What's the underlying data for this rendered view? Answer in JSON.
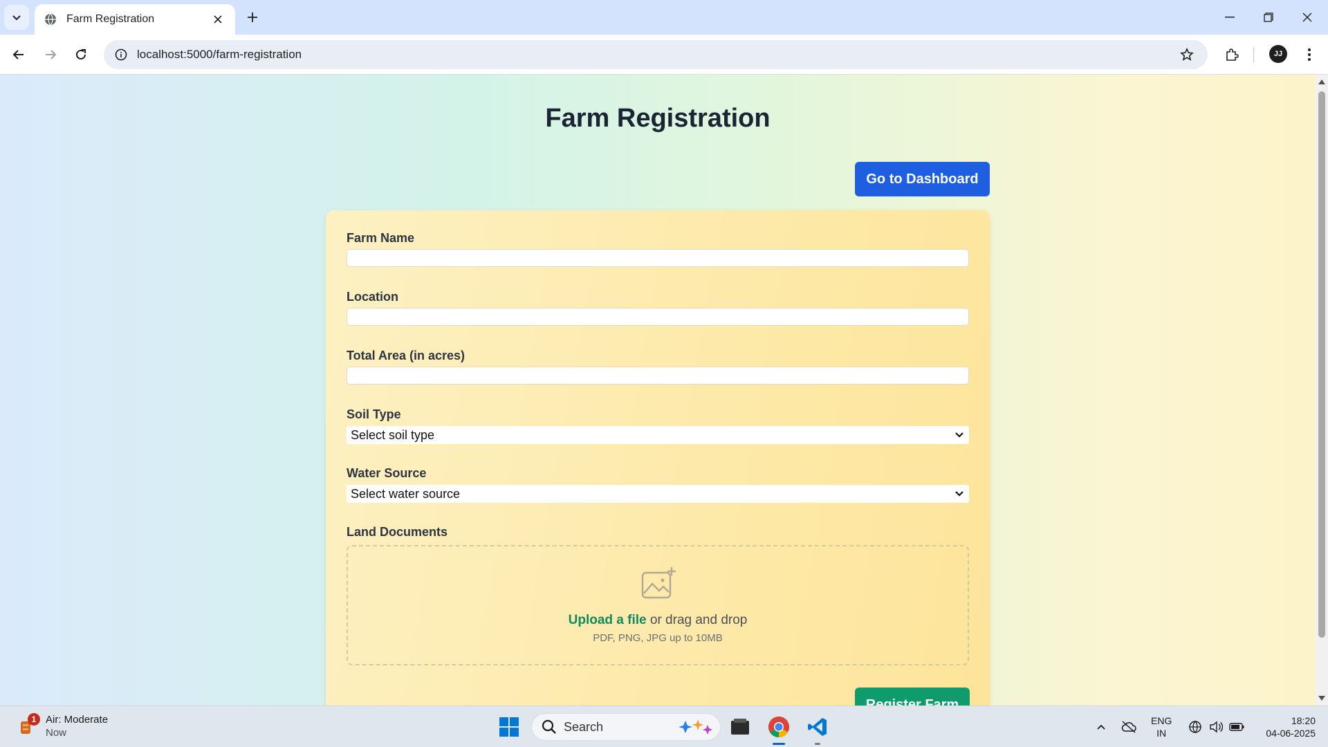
{
  "browser": {
    "tab_title": "Farm Registration",
    "url": "localhost:5000/farm-registration",
    "profile_initials": "JJ"
  },
  "page": {
    "title": "Farm Registration",
    "dashboard_button": "Go to Dashboard",
    "form": {
      "farm_name_label": "Farm Name",
      "farm_name_value": "",
      "location_label": "Location",
      "location_value": "",
      "area_label": "Total Area (in acres)",
      "area_value": "",
      "soil_label": "Soil Type",
      "soil_selected": "Select soil type",
      "water_label": "Water Source",
      "water_selected": "Select water source",
      "docs_label": "Land Documents",
      "upload_link": "Upload a file",
      "upload_rest": "or drag and drop",
      "upload_hint": "PDF, PNG, JPG up to 10MB",
      "submit_button": "Register Farm"
    }
  },
  "taskbar": {
    "weather_badge": "1",
    "weather_title": "Air: Moderate",
    "weather_sub": "Now",
    "search_label": "Search",
    "lang_line1": "ENG",
    "lang_line2": "IN",
    "time": "18:20",
    "date": "04-06-2025"
  },
  "colors": {
    "primary_button": "#1d5fe0",
    "submit_button": "#0f9b6c",
    "link": "#0f8a5f",
    "card": "#fde9a8"
  },
  "icons": [
    "tab-list-icon",
    "globe-favicon-icon",
    "close-icon",
    "plus-icon",
    "minimize-icon",
    "restore-icon",
    "window-close-icon",
    "back-icon",
    "forward-icon",
    "reload-icon",
    "info-icon",
    "star-icon",
    "extensions-icon",
    "more-icon",
    "chevron-down-icon",
    "image-upload-icon",
    "windows-start-icon",
    "search-icon",
    "copilot-icon",
    "file-explorer-icon",
    "chrome-icon",
    "vscode-icon",
    "chevron-up-icon",
    "cloud-off-icon",
    "network-icon",
    "volume-icon",
    "battery-icon"
  ]
}
